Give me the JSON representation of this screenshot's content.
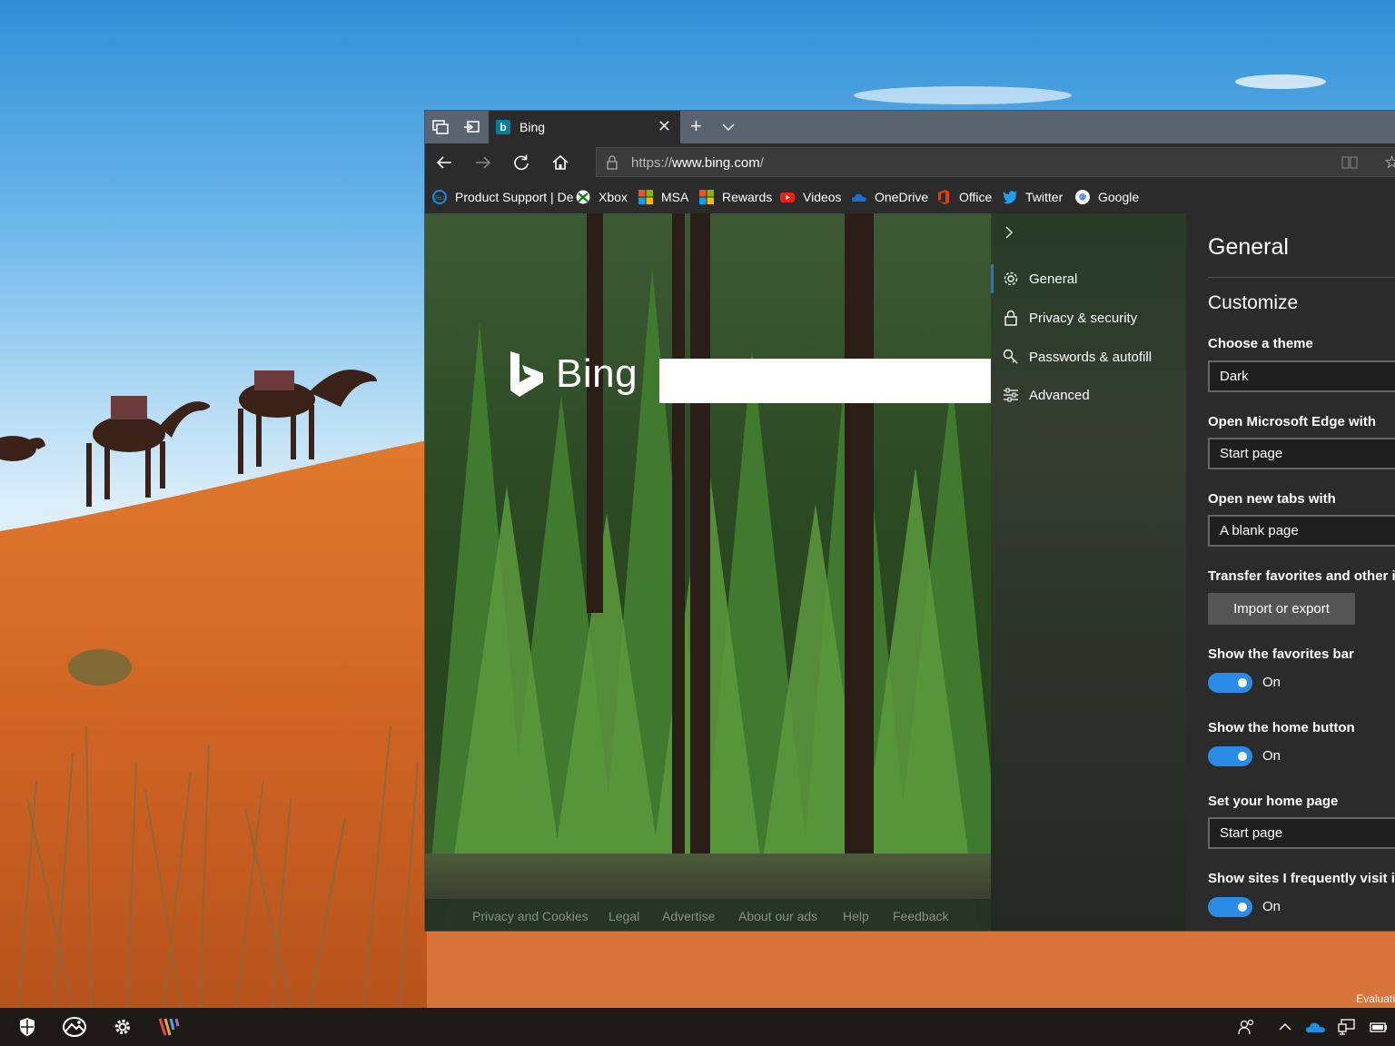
{
  "desktop": {
    "watermark": "Evaluati"
  },
  "browser": {
    "tab": {
      "title": "Bing",
      "favicon": "b"
    },
    "address": {
      "url_prefix": "https://",
      "url_host": "www.bing.com",
      "url_suffix": "/"
    },
    "favorites": [
      {
        "label": "Product Support | De",
        "icon": "dell-icon"
      },
      {
        "label": "Xbox",
        "icon": "xbox-icon"
      },
      {
        "label": "MSA",
        "icon": "microsoft-icon"
      },
      {
        "label": "Rewards",
        "icon": "microsoft-icon"
      },
      {
        "label": "Videos",
        "icon": "youtube-icon"
      },
      {
        "label": "OneDrive",
        "icon": "onedrive-icon"
      },
      {
        "label": "Office",
        "icon": "office-icon"
      },
      {
        "label": "Twitter",
        "icon": "twitter-icon"
      },
      {
        "label": "Google",
        "icon": "google-icon"
      }
    ]
  },
  "bing": {
    "logo_text": "Bing",
    "footer": [
      "Privacy and Cookies",
      "Legal",
      "Advertise",
      "About our ads",
      "Help",
      "Feedback"
    ]
  },
  "settings": {
    "nav": [
      {
        "label": "General",
        "icon": "gear-icon",
        "active": true
      },
      {
        "label": "Privacy & security",
        "icon": "lock-icon"
      },
      {
        "label": "Passwords & autofill",
        "icon": "key-icon"
      },
      {
        "label": "Advanced",
        "icon": "sliders-icon"
      }
    ],
    "title": "General",
    "section": "Customize",
    "theme_label": "Choose a theme",
    "theme_value": "Dark",
    "open_with_label": "Open Microsoft Edge with",
    "open_with_value": "Start page",
    "new_tabs_label": "Open new tabs with",
    "new_tabs_value": "A blank page",
    "transfer_label": "Transfer favorites and other ir",
    "import_button": "Import or export",
    "favbar_label": "Show the favorites bar",
    "favbar_state": "On",
    "home_button_label": "Show the home button",
    "home_button_state": "On",
    "home_page_label": "Set your home page",
    "home_page_value": "Start page",
    "frequent_label": "Show sites I frequently visit ir",
    "frequent_state": "On"
  },
  "colors": {
    "accent": "#2b8ce8",
    "active_marker": "#2b73d0",
    "titlebar": "#5a6470",
    "chrome": "#2b2b2b"
  }
}
